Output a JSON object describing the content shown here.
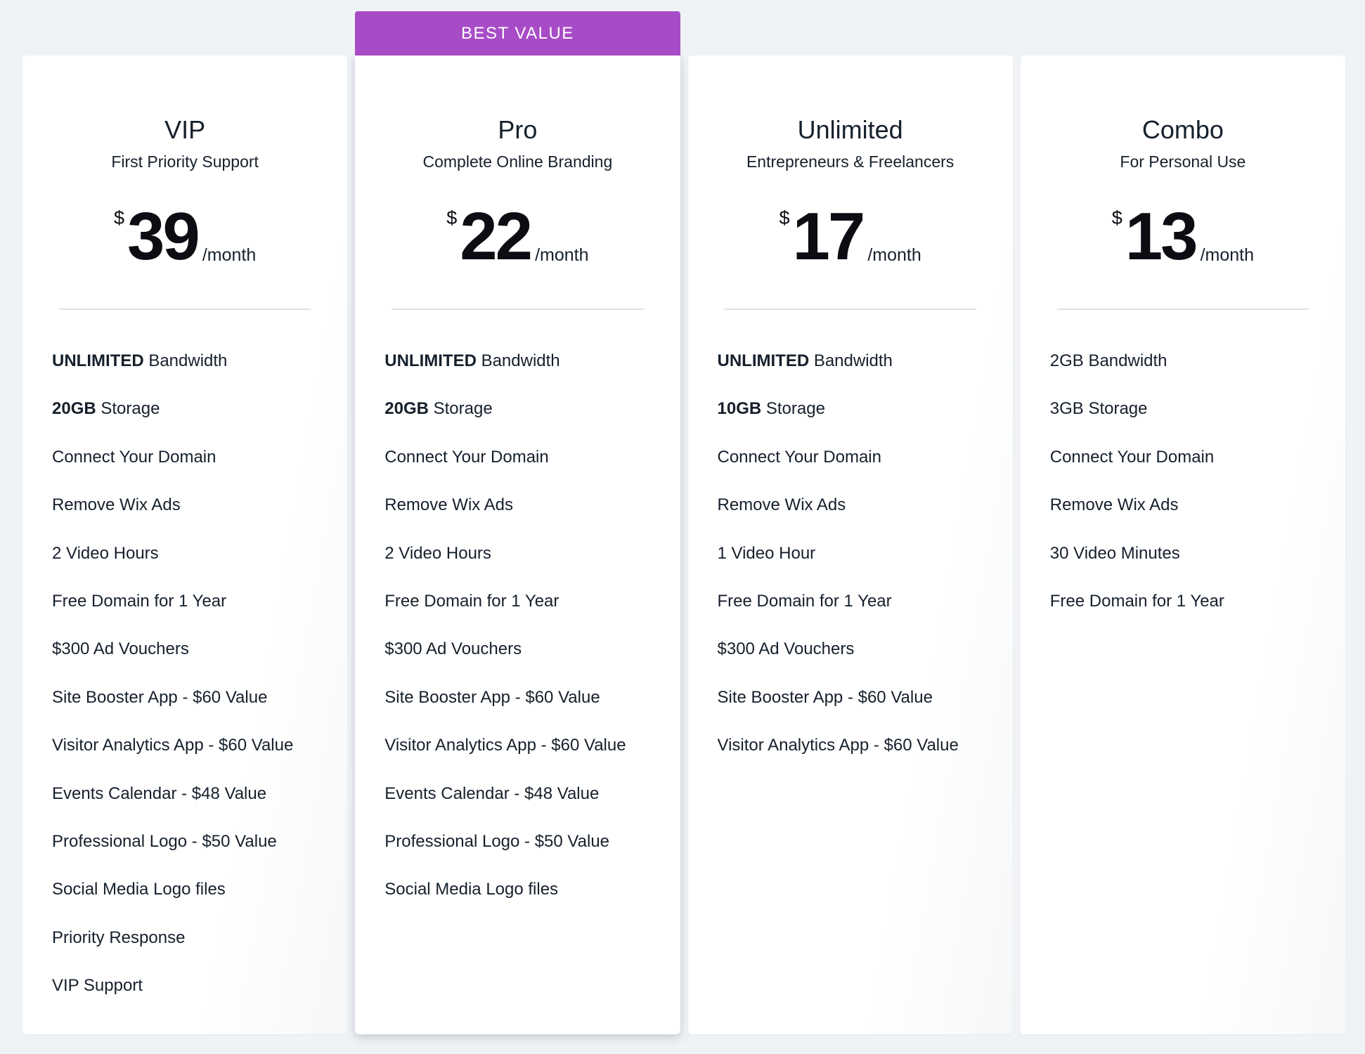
{
  "badge": {
    "label": "BEST VALUE",
    "color": "#a74cc6"
  },
  "colors": {
    "background": "#f0f3f6",
    "card": "#ffffff",
    "text": "#16202c",
    "price_text": "#0b0d12",
    "divider": "#dde1e7"
  },
  "plans": [
    {
      "name": "VIP",
      "subtitle": "First Priority Support",
      "currency": "$",
      "price": "39",
      "period": "/month",
      "featured": false,
      "features": [
        {
          "strong": "UNLIMITED",
          "text": " Bandwidth"
        },
        {
          "strong": "20GB",
          "text": " Storage"
        },
        {
          "strong": "",
          "text": "Connect Your Domain"
        },
        {
          "strong": "",
          "text": "Remove Wix Ads"
        },
        {
          "strong": "",
          "text": "2 Video Hours"
        },
        {
          "strong": "",
          "text": "Free Domain for 1 Year"
        },
        {
          "strong": "",
          "text": "$300 Ad Vouchers"
        },
        {
          "strong": "",
          "text": "Site Booster App - $60 Value"
        },
        {
          "strong": "",
          "text": "Visitor Analytics App - $60 Value"
        },
        {
          "strong": "",
          "text": "Events Calendar - $48 Value"
        },
        {
          "strong": "",
          "text": "Professional Logo - $50 Value"
        },
        {
          "strong": "",
          "text": "Social Media Logo files"
        },
        {
          "strong": "",
          "text": "Priority Response"
        },
        {
          "strong": "",
          "text": "VIP Support"
        }
      ]
    },
    {
      "name": "Pro",
      "subtitle": "Complete Online Branding",
      "currency": "$",
      "price": "22",
      "period": "/month",
      "featured": true,
      "features": [
        {
          "strong": "UNLIMITED",
          "text": " Bandwidth"
        },
        {
          "strong": "20GB",
          "text": " Storage"
        },
        {
          "strong": "",
          "text": "Connect Your Domain"
        },
        {
          "strong": "",
          "text": "Remove Wix Ads"
        },
        {
          "strong": "",
          "text": "2 Video Hours"
        },
        {
          "strong": "",
          "text": "Free Domain for 1 Year"
        },
        {
          "strong": "",
          "text": "$300 Ad Vouchers"
        },
        {
          "strong": "",
          "text": "Site Booster App - $60 Value"
        },
        {
          "strong": "",
          "text": "Visitor Analytics App - $60 Value"
        },
        {
          "strong": "",
          "text": "Events Calendar - $48 Value"
        },
        {
          "strong": "",
          "text": "Professional Logo - $50 Value"
        },
        {
          "strong": "",
          "text": "Social Media Logo files"
        }
      ]
    },
    {
      "name": "Unlimited",
      "subtitle": "Entrepreneurs & Freelancers",
      "currency": "$",
      "price": "17",
      "period": "/month",
      "featured": false,
      "features": [
        {
          "strong": "UNLIMITED",
          "text": " Bandwidth"
        },
        {
          "strong": "10GB",
          "text": " Storage"
        },
        {
          "strong": "",
          "text": "Connect Your Domain"
        },
        {
          "strong": "",
          "text": "Remove Wix Ads"
        },
        {
          "strong": "",
          "text": "1 Video Hour"
        },
        {
          "strong": "",
          "text": "Free Domain for 1 Year"
        },
        {
          "strong": "",
          "text": "$300 Ad Vouchers"
        },
        {
          "strong": "",
          "text": "Site Booster App - $60 Value"
        },
        {
          "strong": "",
          "text": "Visitor Analytics App - $60 Value"
        }
      ]
    },
    {
      "name": "Combo",
      "subtitle": "For Personal Use",
      "currency": "$",
      "price": "13",
      "period": "/month",
      "featured": false,
      "features": [
        {
          "strong": "",
          "text": "2GB Bandwidth"
        },
        {
          "strong": "",
          "text": "3GB Storage"
        },
        {
          "strong": "",
          "text": "Connect Your Domain"
        },
        {
          "strong": "",
          "text": "Remove Wix Ads"
        },
        {
          "strong": "",
          "text": "30 Video Minutes"
        },
        {
          "strong": "",
          "text": "Free Domain for 1 Year"
        }
      ]
    }
  ]
}
